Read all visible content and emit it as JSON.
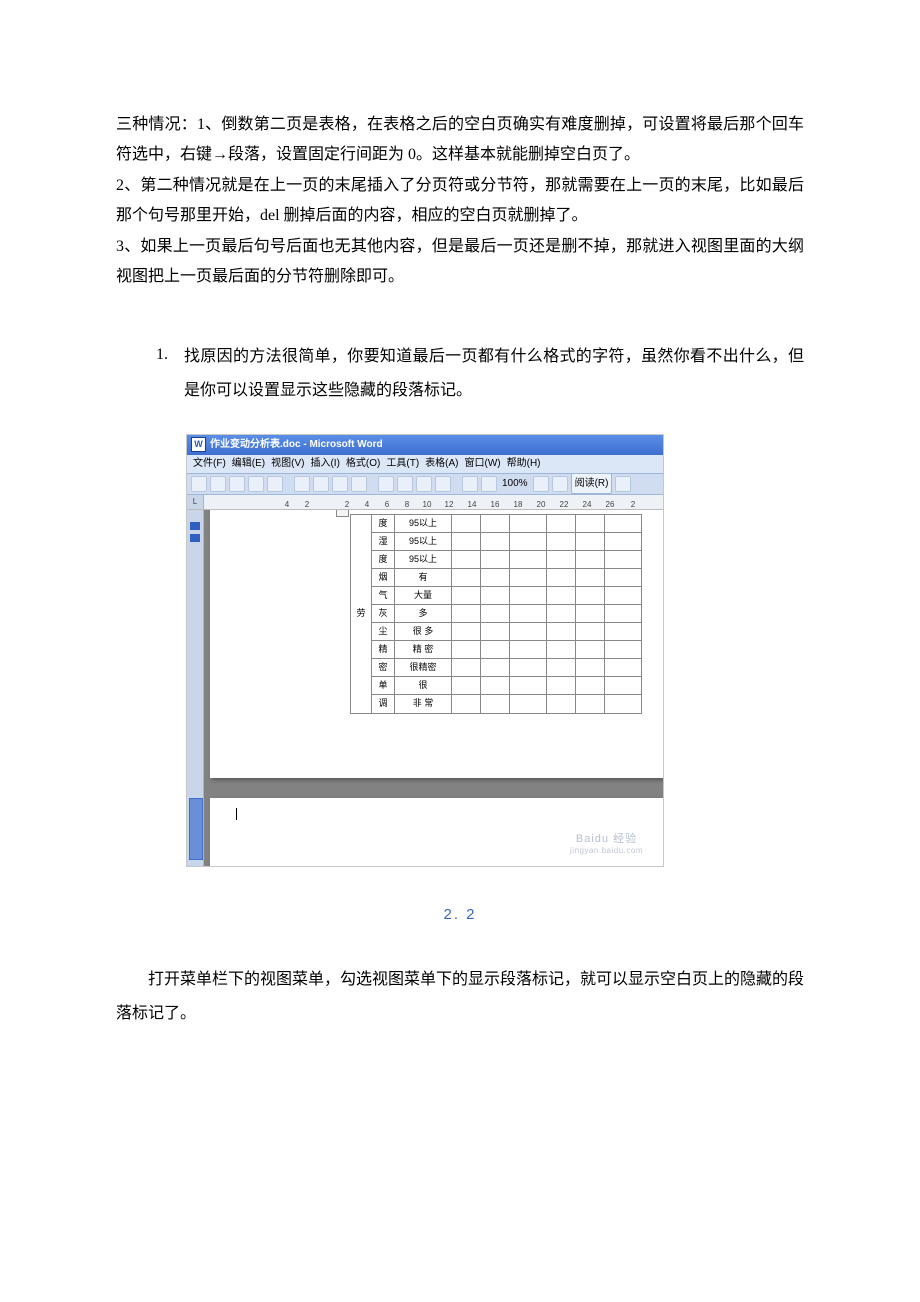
{
  "lead": {
    "p1": "三种情况：1、倒数第二页是表格，在表格之后的空白页确实有难度删掉，可设置将最后那个回车符选中，右键→段落，设置固定行间距为 0。这样基本就能删掉空白页了。",
    "p2": "2、第二种情况就是在上一页的末尾插入了分页符或分节符，那就需要在上一页的末尾，比如最后那个句号那里开始，del 删掉后面的内容，相应的空白页就删掉了。",
    "p3": "3、如果上一页最后句号后面也无其他内容，但是最后一页还是删不掉，那就进入视图里面的大纲视图把上一页最后面的分节符删除即可。"
  },
  "step": {
    "num": "1.",
    "text": "找原因的方法很简单，你要知道最后一页都有什么格式的字符，虽然你看不出什么，但是你可以设置显示这些隐藏的段落标记。"
  },
  "word": {
    "icon": "W",
    "title": "作业变动分析表.doc - Microsoft Word",
    "menus": [
      "文件(F)",
      "编辑(E)",
      "视图(V)",
      "插入(I)",
      "格式(O)",
      "工具(T)",
      "表格(A)",
      "窗口(W)",
      "帮助(H)"
    ],
    "zoom": "100%",
    "read": "阅读(R)",
    "ruler_marks": [
      "4",
      "2",
      "2",
      "4",
      "6",
      "8",
      "10",
      "12",
      "14",
      "16",
      "18",
      "20",
      "22",
      "24",
      "26",
      "2"
    ],
    "table": {
      "side": "劳",
      "rows": [
        {
          "c1": "度",
          "c2": "95以上"
        },
        {
          "c1": "湿",
          "c2": "95以上"
        },
        {
          "c1": "度",
          "c2": "95以上"
        },
        {
          "c1": "烟",
          "c2": "有"
        },
        {
          "c1": "气",
          "c2": "大量"
        },
        {
          "c1": "灰",
          "c2": "多"
        },
        {
          "c1": "尘",
          "c2": "很 多"
        },
        {
          "c1": "精",
          "c2": "精 密"
        },
        {
          "c1": "密",
          "c2": "很精密"
        },
        {
          "c1": "单",
          "c2": "很"
        },
        {
          "c1": "调",
          "c2": "非 常"
        }
      ]
    },
    "watermark": "Baidu 经验",
    "watermark_sub": "jingyan.baidu.com"
  },
  "step_link": "2. 2",
  "after": "打开菜单栏下的视图菜单，勾选视图菜单下的显示段落标记，就可以显示空白页上的隐藏的段落标记了。"
}
